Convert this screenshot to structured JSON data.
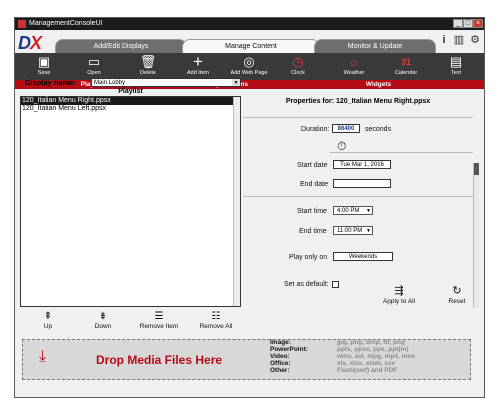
{
  "window": {
    "title": "ManagementConsoleUI"
  },
  "logo": {
    "text_d": "D",
    "text_x": "X"
  },
  "tabs": [
    {
      "label": "Add/Edit Displays",
      "active": false
    },
    {
      "label": "Manage Content",
      "active": true
    },
    {
      "label": "Monitor & Update",
      "active": false
    }
  ],
  "top_icons": [
    "info-icon",
    "book-icon",
    "gear-icon"
  ],
  "toolbar": {
    "save": "Save",
    "open": "Open",
    "delete": "Delete",
    "add_item": "Add Item",
    "add_web_page": "Add Web Page",
    "clock": "Clock",
    "weather": "Weather",
    "calendar": "Calendar",
    "text": "Text",
    "calendar_day": "31"
  },
  "sections": {
    "playlist": "Playlist",
    "add_playlist_items": "Add Playlist Items",
    "widgets": "Widgets"
  },
  "display": {
    "label": "Display name:",
    "value": "Main Lobby"
  },
  "playlist": {
    "header": "Playlist",
    "items": [
      "120_Italian Menu Right.ppsx",
      "120_Italian Menu Left.ppsx"
    ]
  },
  "playlist_buttons": {
    "up": "Up",
    "down": "Down",
    "remove_item": "Remove Item",
    "remove_all": "Remove All"
  },
  "properties": {
    "title": "Properties for: 120_Italian Menu Right.ppsx",
    "duration_label": "Duration:",
    "duration_value": "86400",
    "duration_unit": "seconds",
    "start_date_label": "Start date",
    "start_date_value": "Tue Mar 1, 2016",
    "end_date_label": "End date",
    "end_date_value": "",
    "start_time_label": "Start time",
    "start_time_value": "4:00 PM",
    "end_time_label": "End time",
    "end_time_value": "11:00 PM",
    "play_only_on_label": "Play only on",
    "play_only_on_value": "Weekends",
    "set_as_default_label": "Set as default:",
    "apply_to_all": "Apply to All",
    "reset": "Reset"
  },
  "drop": {
    "text": "Drop Media Files Here",
    "types": [
      {
        "label": "Image:",
        "value": "jpg, png, bmp, tif, png"
      },
      {
        "label": "PowerPoint:",
        "value": "pptx, ppsx, pps, ppt(m)"
      },
      {
        "label": "Video:",
        "value": "wmv, avi, mpg, mp4, mov"
      },
      {
        "label": "Office:",
        "value": "xls, xlsx, xlsm, csv"
      },
      {
        "label": "Other:",
        "value": "Flash(swf) and PDF"
      }
    ]
  },
  "colors": {
    "accent_red": "#b50b14",
    "toolbar": "#3a3a3a",
    "logo_blue": "#1f3c8c"
  }
}
